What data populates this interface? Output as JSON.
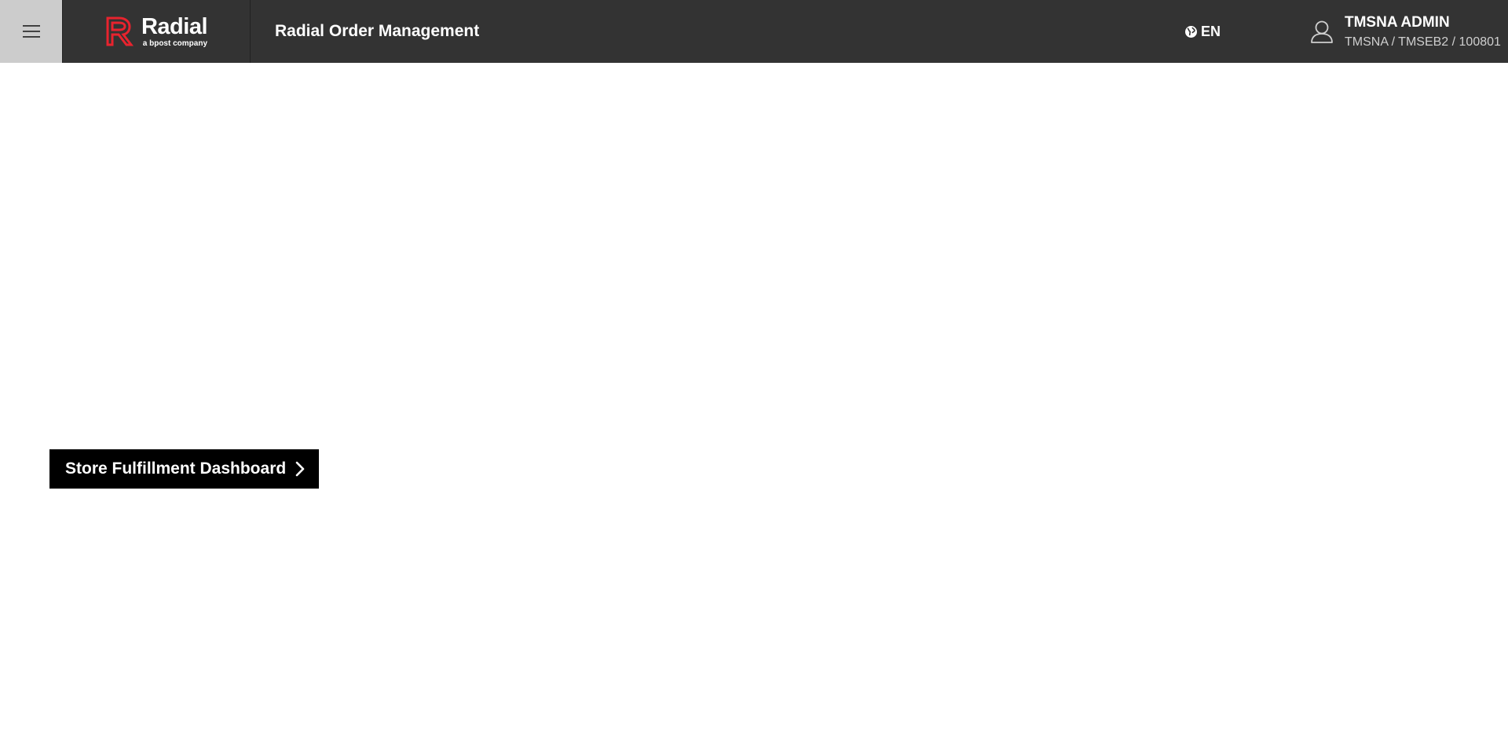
{
  "header": {
    "menu_icon": "hamburger-menu-icon",
    "logo": {
      "name": "Radial",
      "tagline": "a bpost company",
      "accent_color": "#e8232e"
    },
    "app_title": "Radial Order Management",
    "language": {
      "icon": "globe-icon",
      "code": "EN"
    },
    "user": {
      "icon": "user-icon",
      "name": "TMSNA ADMIN",
      "org": "TMSNA / TMSEB2 / 100801"
    },
    "colors": {
      "bar_background": "#333333",
      "menu_button_background": "#cccccc"
    }
  },
  "main": {
    "dashboard_button": {
      "label": "Store Fulfillment Dashboard",
      "icon": "chevron-right-icon",
      "background": "#000000"
    }
  }
}
